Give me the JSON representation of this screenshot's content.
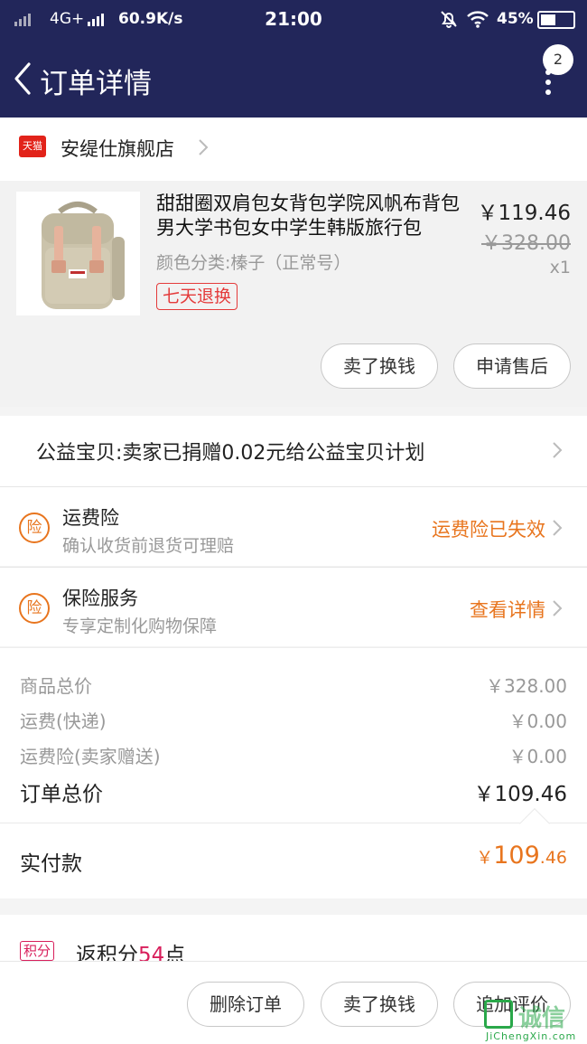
{
  "status_bar": {
    "network": "4G+",
    "speed": "60.9K/s",
    "time": "21:00",
    "battery": "45%"
  },
  "nav": {
    "title": "订单详情",
    "badge_count": "2"
  },
  "store": {
    "platform_badge": "天猫",
    "name": "安缇仕旗舰店"
  },
  "product": {
    "title": "甜甜圈双肩包女背包学院风帆布背包男大学书包女中学生韩版旅行包",
    "price": "￥119.46",
    "original_price": "￥328.00",
    "quantity": "x1",
    "spec": "颜色分类:榛子（正常号）",
    "tag": "七天退换",
    "buttons": {
      "sell": "卖了换钱",
      "after_sale": "申请售后"
    }
  },
  "charity": {
    "text": "公益宝贝:卖家已捐赠0.02元给公益宝贝计划"
  },
  "insurance": [
    {
      "icon_text": "险",
      "title": "运费险",
      "subtitle": "确认收货前退货可理赔",
      "status": "运费险已失效"
    },
    {
      "icon_text": "险",
      "title": "保险服务",
      "subtitle": "专享定制化购物保障",
      "status": "查看详情"
    }
  ],
  "summary": {
    "rows": [
      {
        "label": "商品总价",
        "value": "￥328.00"
      },
      {
        "label": "运费(快递)",
        "value": "￥0.00"
      },
      {
        "label": "运费险(卖家赠送)",
        "value": "￥0.00"
      }
    ],
    "total_label": "订单总价",
    "total_value": "￥109.46"
  },
  "paid": {
    "label": "实付款",
    "currency": "￥",
    "integer": "109",
    "decimal": ".46"
  },
  "points": {
    "badge": "积分",
    "prefix": "返积分",
    "amount": "54",
    "suffix": "点"
  },
  "bottom_actions": {
    "delete": "删除订单",
    "sell": "卖了换钱",
    "review": "追加评价"
  },
  "watermark": {
    "main": "诚信",
    "sub": "JiChengXin.com"
  },
  "colors": {
    "header_bg": "#22265a",
    "accent_orange": "#e8751e",
    "tmall_red": "#e2231a",
    "points_red": "#d81e5b"
  }
}
